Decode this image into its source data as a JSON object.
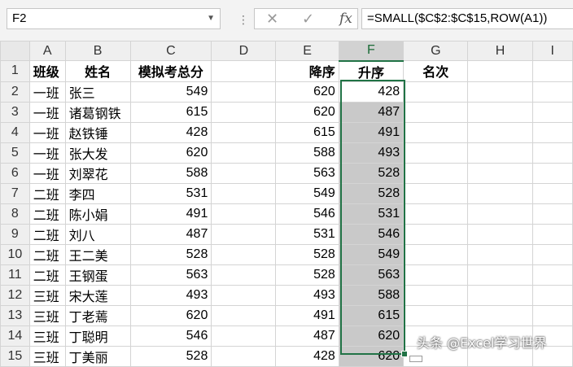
{
  "formula_bar": {
    "name_box": "F2",
    "cancel_icon": "✕",
    "enter_icon": "✓",
    "fx_label": "fx",
    "formula": "=SMALL($C$2:$C$15,ROW(A1))"
  },
  "columns": [
    "A",
    "B",
    "C",
    "D",
    "E",
    "F",
    "G",
    "H",
    "I"
  ],
  "headers": {
    "A": "班级",
    "B": "姓名",
    "C": "模拟考总分",
    "E": "降序",
    "F": "升序",
    "G": "名次"
  },
  "rows": [
    {
      "row": "2",
      "class": "一班",
      "name": "张三",
      "score": "549",
      "desc": "620",
      "asc": "428"
    },
    {
      "row": "3",
      "class": "一班",
      "name": "诸葛钢铁",
      "score": "615",
      "desc": "620",
      "asc": "487"
    },
    {
      "row": "4",
      "class": "一班",
      "name": "赵铁锤",
      "score": "428",
      "desc": "615",
      "asc": "491"
    },
    {
      "row": "5",
      "class": "一班",
      "name": "张大发",
      "score": "620",
      "desc": "588",
      "asc": "493"
    },
    {
      "row": "6",
      "class": "一班",
      "name": "刘翠花",
      "score": "588",
      "desc": "563",
      "asc": "528"
    },
    {
      "row": "7",
      "class": "二班",
      "name": "李四",
      "score": "531",
      "desc": "549",
      "asc": "528"
    },
    {
      "row": "8",
      "class": "二班",
      "name": "陈小娟",
      "score": "491",
      "desc": "546",
      "asc": "531"
    },
    {
      "row": "9",
      "class": "二班",
      "name": "刘八",
      "score": "487",
      "desc": "531",
      "asc": "546"
    },
    {
      "row": "10",
      "class": "二班",
      "name": "王二美",
      "score": "528",
      "desc": "528",
      "asc": "549"
    },
    {
      "row": "11",
      "class": "二班",
      "name": "王钢蛋",
      "score": "563",
      "desc": "528",
      "asc": "563"
    },
    {
      "row": "12",
      "class": "三班",
      "name": "宋大莲",
      "score": "493",
      "desc": "493",
      "asc": "588"
    },
    {
      "row": "13",
      "class": "三班",
      "name": "丁老蔫",
      "score": "620",
      "desc": "491",
      "asc": "615"
    },
    {
      "row": "14",
      "class": "三班",
      "name": "丁聪明",
      "score": "546",
      "desc": "487",
      "asc": "620"
    },
    {
      "row": "15",
      "class": "三班",
      "name": "丁美丽",
      "score": "528",
      "desc": "428",
      "asc": "620"
    }
  ],
  "watermark": "头条 @Excel学习世界",
  "colors": {
    "selection": "#217346",
    "selected_fill": "#c9c9c9"
  }
}
